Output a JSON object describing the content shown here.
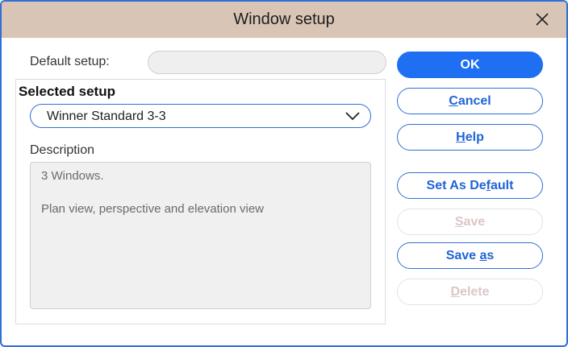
{
  "window": {
    "title": "Window setup"
  },
  "icons": {
    "close": "close-icon",
    "dropdown": "chevron-down-icon"
  },
  "colors": {
    "accent": "#1f6ff2",
    "titlebar": "#d9c5b5",
    "border": "#2f6fd6"
  },
  "default_setup": {
    "label": "Default setup:",
    "value": ""
  },
  "selected_setup": {
    "group_title": "Selected setup",
    "value": "Winner Standard 3-3"
  },
  "description": {
    "label": "Description",
    "line1": "3 Windows.",
    "line2": "Plan view, perspective and elevation view"
  },
  "buttons": {
    "ok": "OK",
    "cancel": {
      "pre": "",
      "ul": "C",
      "post": "ancel"
    },
    "help": {
      "pre": "",
      "ul": "H",
      "post": "elp"
    },
    "set_default": {
      "pre": "Set As De",
      "ul": "f",
      "post": "ault"
    },
    "save": {
      "pre": "",
      "ul": "S",
      "post": "ave"
    },
    "save_as": {
      "pre": "Save ",
      "ul": "a",
      "post": "s"
    },
    "delete": {
      "pre": "",
      "ul": "D",
      "post": "elete"
    }
  }
}
